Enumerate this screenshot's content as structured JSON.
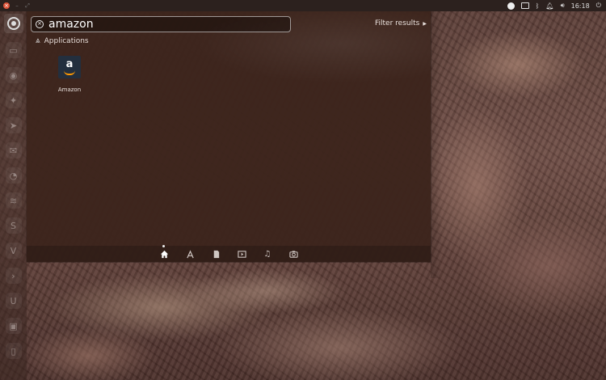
{
  "panel": {
    "clock": "16:18"
  },
  "search": {
    "query": "amazon",
    "placeholder": ""
  },
  "filter": {
    "label": "Filter results"
  },
  "category": {
    "label": "Applications"
  },
  "results": [
    {
      "label": "Amazon",
      "icon": "amazon-icon"
    }
  ],
  "lenses": [
    {
      "name": "home-lens-icon",
      "active": true
    },
    {
      "name": "applications-lens-icon",
      "active": false
    },
    {
      "name": "files-lens-icon",
      "active": false
    },
    {
      "name": "video-lens-icon",
      "active": false
    },
    {
      "name": "music-lens-icon",
      "active": false
    },
    {
      "name": "photos-lens-icon",
      "active": false
    }
  ],
  "colors": {
    "close_button": "#e0553a",
    "amazon_tile": "#232f3e",
    "amazon_smile": "#ff9900"
  }
}
